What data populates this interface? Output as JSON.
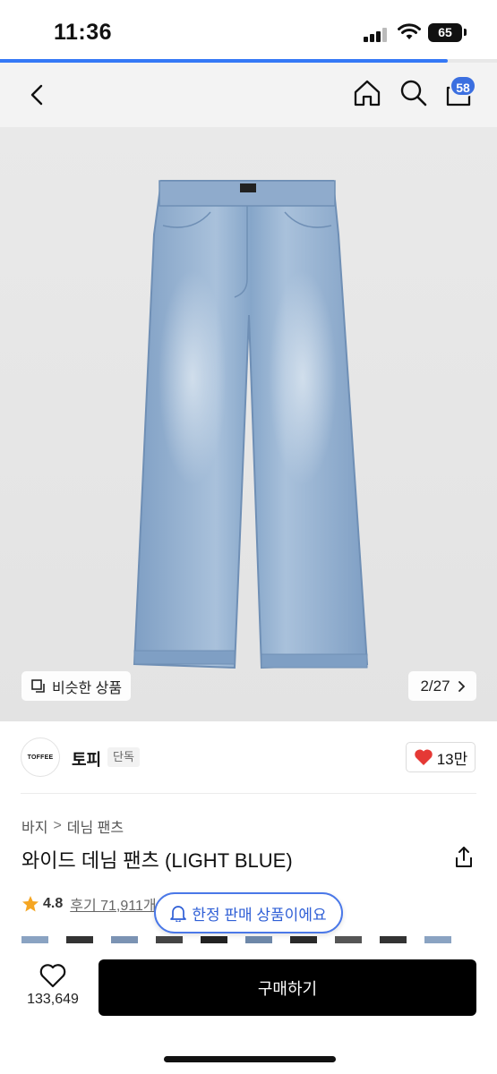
{
  "status_bar": {
    "time": "11:36",
    "battery": "65"
  },
  "page_progress": 0.9,
  "nav": {
    "cart_count": "58",
    "icons": [
      "chevron-left-icon",
      "home-icon",
      "search-icon",
      "shopping-bag-icon"
    ]
  },
  "gallery": {
    "similar_label": "비슷한 상품",
    "page_counter": "2/27"
  },
  "brand": {
    "logo_text": "TOFFEE",
    "name": "토피",
    "tag": "단독",
    "like_count": "13만"
  },
  "product": {
    "breadcrumb": [
      "바지",
      "데님 팬츠"
    ],
    "title": "와이드 데님 팬츠 (LIGHT BLUE)",
    "rating": "4.8",
    "review_label": "후기 71,911개"
  },
  "notice": {
    "limited_label": "한정 판매 상품이에요"
  },
  "bottom": {
    "wish_count": "133,649",
    "buy_label": "구매하기"
  },
  "colors": {
    "accent": "#3b6fe0",
    "heart": "#e53935",
    "star": "#f5a623",
    "button": "#000000"
  }
}
